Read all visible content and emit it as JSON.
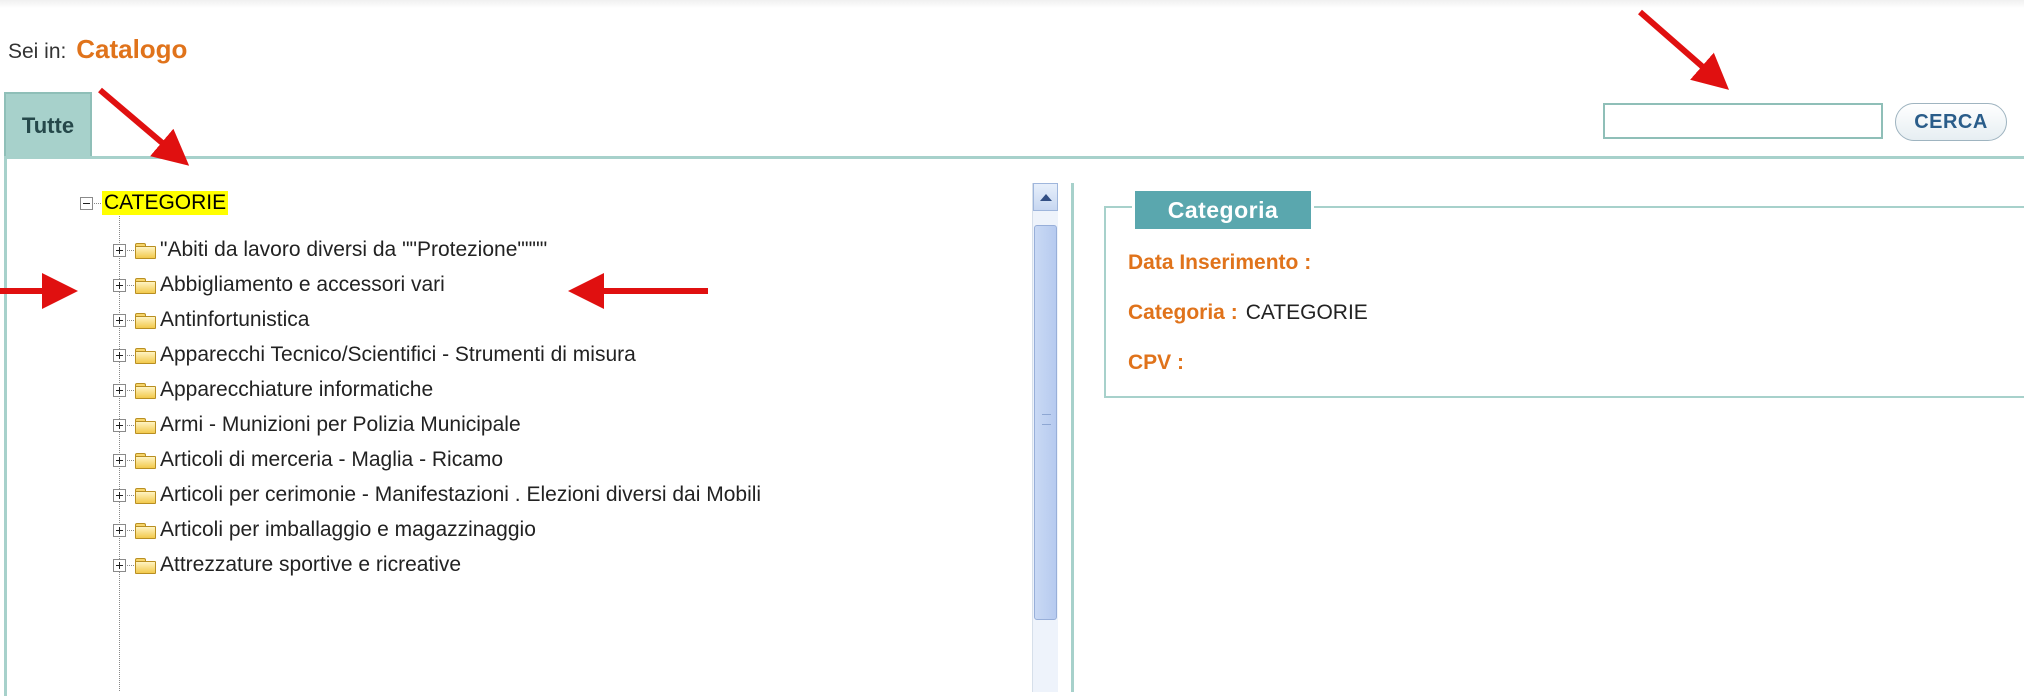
{
  "breadcrumb": {
    "prefix": "Sei in:",
    "current": "Catalogo"
  },
  "tabs": [
    {
      "label": "Tutte"
    }
  ],
  "search": {
    "value": "",
    "button_label": "CERCA"
  },
  "tree": {
    "root_label": "CATEGORIE",
    "items": [
      {
        "label": "\"Abiti da lavoro diversi da \"\"Protezione\"\"\"\""
      },
      {
        "label": "Abbigliamento e accessori vari"
      },
      {
        "label": "Antinfortunistica"
      },
      {
        "label": "Apparecchi Tecnico/Scientifici - Strumenti di misura"
      },
      {
        "label": "Apparecchiature informatiche"
      },
      {
        "label": "Armi - Munizioni per Polizia Municipale"
      },
      {
        "label": "Articoli di merceria - Maglia - Ricamo"
      },
      {
        "label": "Articoli per cerimonie - Manifestazioni . Elezioni diversi dai Mobili"
      },
      {
        "label": "Articoli per imballaggio e magazzinaggio"
      },
      {
        "label": "Attrezzature sportive e ricreative"
      }
    ]
  },
  "detail": {
    "title": "Categoria",
    "fields": [
      {
        "label": "Data Inserimento :",
        "value": ""
      },
      {
        "label": "Categoria :",
        "value": "CATEGORIE"
      },
      {
        "label": "CPV :",
        "value": ""
      }
    ]
  },
  "colors": {
    "accent": "#e0731b",
    "teal": "#a7d1cb",
    "title_bg": "#5aa7ae",
    "highlight": "#ffff00",
    "annotation": "#e01010"
  }
}
